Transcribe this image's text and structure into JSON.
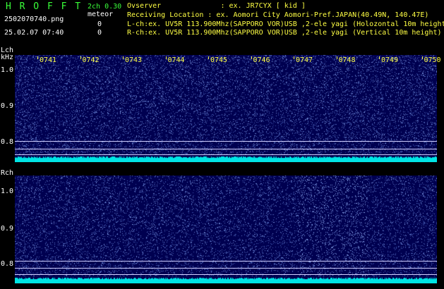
{
  "header": {
    "logo": "H R O F F T",
    "version": "2ch 0.30",
    "filename": "2502070740.png",
    "meteor_label": "meteor",
    "lch_count": "0",
    "rch_count": "0",
    "datetime": "25.02.07 07:40",
    "observer": "Ovserver              : ex. JR7CYX [ kid ]",
    "location": "Receiving Location : ex. Aomori City Aomori-Pref.JAPAN(40.49N, 140.47E)",
    "lch_info": "L-ch:ex. UV5R 113.900Mhz(SAPPORO VOR)USB ,2-ele yagi (Holozontal 10m height)",
    "rch_info": "R-ch:ex. UV5R 113.900Mhz(SAPPORO VOR)USB ,2-ele yagi (Vertical 10m height)"
  },
  "lch": {
    "label": "Lch",
    "unit": "kHz",
    "ticks": [
      "1.0",
      "0.9",
      "0.8"
    ]
  },
  "rch": {
    "label": "Rch",
    "ticks": [
      "1.0",
      "0.9",
      "0.8"
    ]
  },
  "time_labels": [
    "0741",
    "0742",
    "0743",
    "0744",
    "0745",
    "0746",
    "0747",
    "0748",
    "0749",
    "0750"
  ],
  "colors": {
    "background": "#000050",
    "noise": "#4c6cff",
    "baseline": "#00e5e5",
    "header_green": "#39ff39",
    "header_yellow": "#ffff44"
  }
}
